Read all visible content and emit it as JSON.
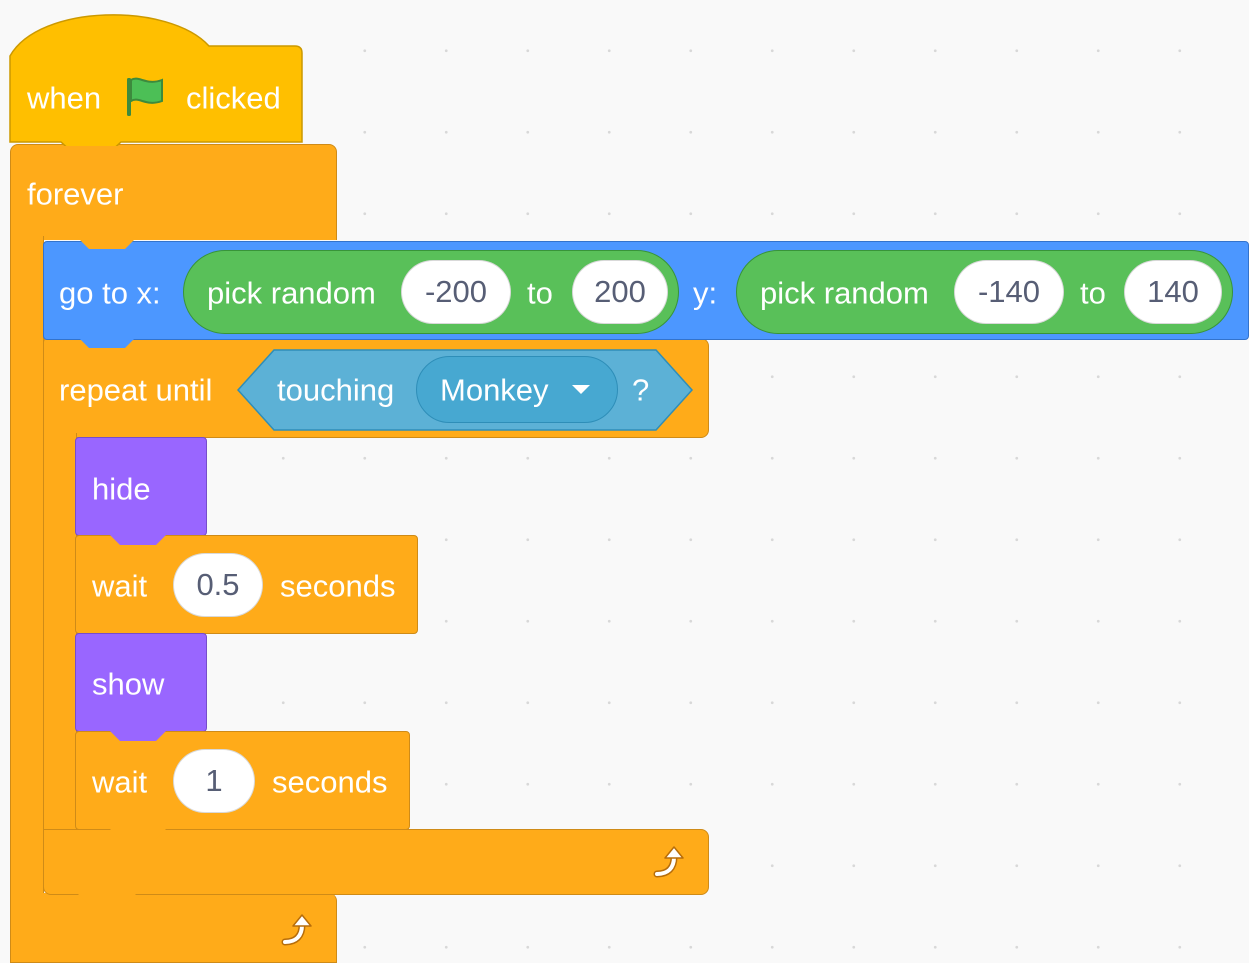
{
  "script": {
    "hat": {
      "when": "when",
      "flag_icon": "green-flag-icon",
      "clicked": "clicked"
    },
    "forever": {
      "label": "forever"
    },
    "goto": {
      "label": "go to x:",
      "x_reporter": {
        "label": "pick random",
        "from": "-200",
        "to_label": "to",
        "to": "200"
      },
      "y_label": "y:",
      "y_reporter": {
        "label": "pick random",
        "from": "-140",
        "to_label": "to",
        "to": "140"
      }
    },
    "repeat_until": {
      "label": "repeat until",
      "condition": {
        "label": "touching",
        "target": "Monkey",
        "question": "?"
      }
    },
    "hide": {
      "label": "hide"
    },
    "wait1": {
      "label": "wait",
      "value": "0.5",
      "unit": "seconds"
    },
    "show": {
      "label": "show"
    },
    "wait2": {
      "label": "wait",
      "value": "1",
      "unit": "seconds"
    },
    "loop_icon": "loop-arrow-icon"
  },
  "colors": {
    "events": "#FFBF00",
    "control": "#FFAB19",
    "motion": "#4C97FF",
    "operators": "#59C059",
    "sensing": "#5CB1D6",
    "looks": "#9966FF"
  }
}
